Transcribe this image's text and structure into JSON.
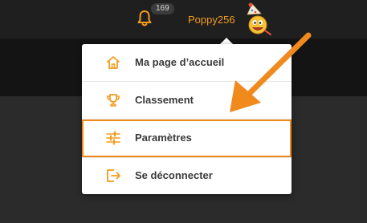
{
  "header": {
    "notification_count": "169",
    "username": "Poppy256"
  },
  "menu": {
    "items": [
      {
        "label": "Ma page d’accueil",
        "icon": "home-icon"
      },
      {
        "label": "Classement",
        "icon": "trophy-icon"
      },
      {
        "label": "Paramètres",
        "icon": "sliders-icon"
      },
      {
        "label": "Se déconnecter",
        "icon": "logout-icon"
      }
    ],
    "highlighted_item": "Paramètres"
  },
  "colors": {
    "accent": "#f39c1f",
    "highlight_border": "#f0891c",
    "annotation_arrow": "#f08a1c",
    "topbar": "#1f1f1f",
    "menu_background": "#ffffff"
  }
}
